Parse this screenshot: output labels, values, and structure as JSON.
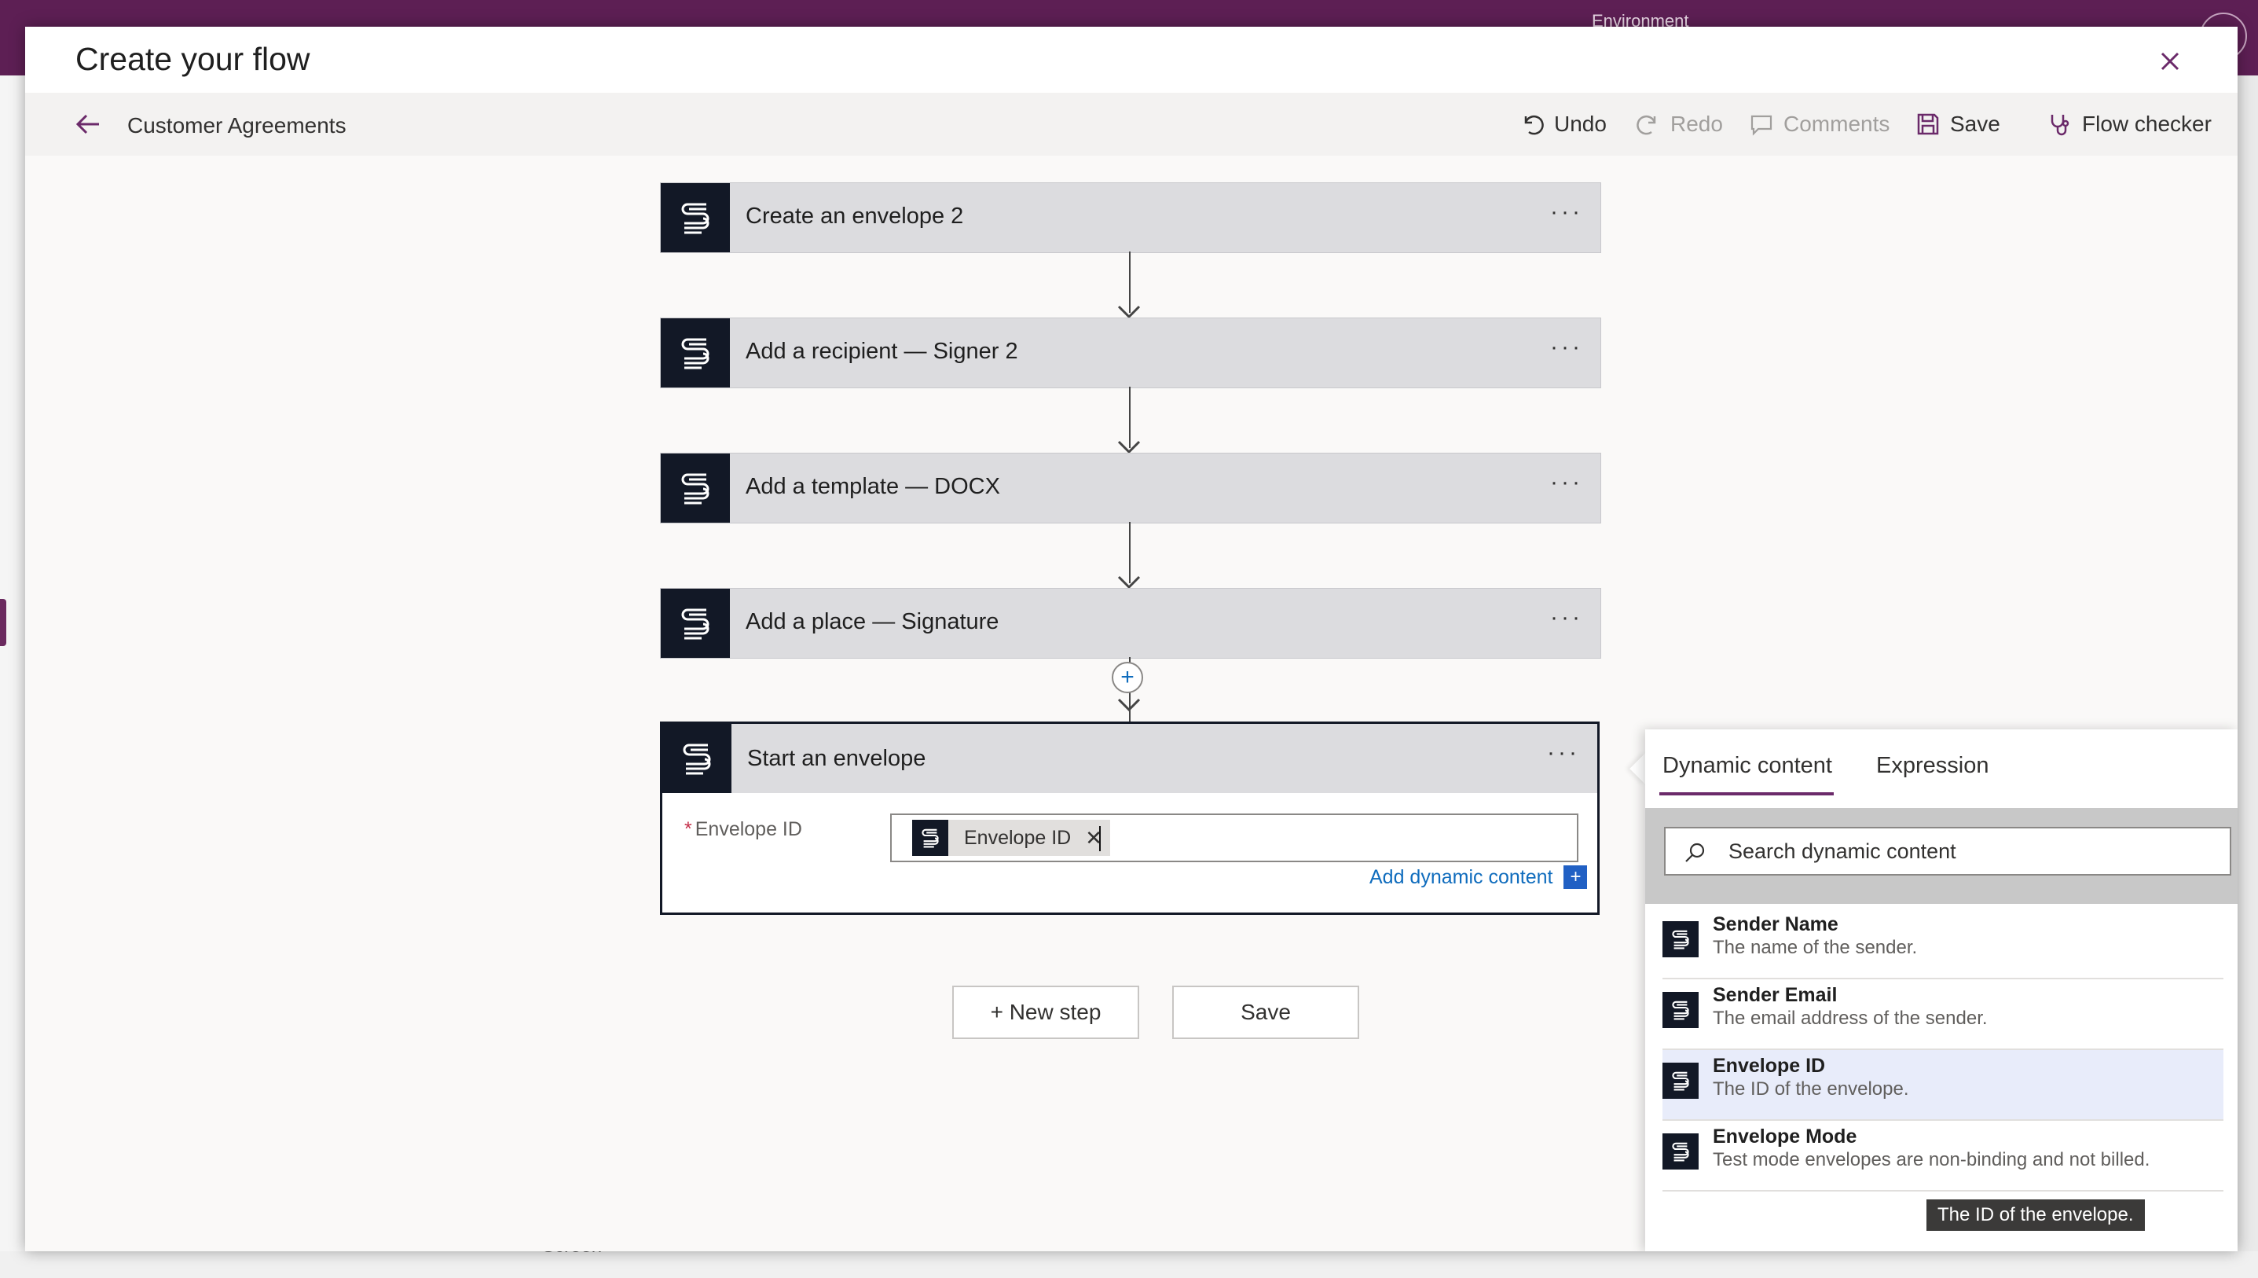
{
  "background": {
    "environment_label": "Environment",
    "screen_label": "Screen"
  },
  "dialog": {
    "title": "Create your flow",
    "close_icon": "close-icon"
  },
  "toolbar": {
    "flow_name": "Customer Agreements",
    "undo": "Undo",
    "redo": "Redo",
    "comments": "Comments",
    "save": "Save",
    "flow_checker": "Flow checker"
  },
  "steps": [
    {
      "title": "Create an envelope 2"
    },
    {
      "title": "Add a recipient — Signer 2"
    },
    {
      "title": "Add a template — DOCX"
    },
    {
      "title": "Add a place — Signature"
    }
  ],
  "active_step": {
    "title": "Start an envelope",
    "field_label": "Envelope ID",
    "token_label": "Envelope ID",
    "add_dynamic": "Add dynamic content"
  },
  "buttons": {
    "new_step": "+ New step",
    "save": "Save"
  },
  "dynamic_panel": {
    "tab_dynamic": "Dynamic content",
    "tab_expression": "Expression",
    "search_placeholder": "Search dynamic content",
    "items": [
      {
        "name": "Sender Name",
        "desc": "The name of the sender."
      },
      {
        "name": "Sender Email",
        "desc": "The email address of the sender."
      },
      {
        "name": "Envelope ID",
        "desc": "The ID of the envelope."
      },
      {
        "name": "Envelope Mode",
        "desc": "Test mode envelopes are non-binding and not billed."
      }
    ],
    "tooltip": "The ID of the envelope."
  },
  "colors": {
    "brand_purple": "#5d1f54",
    "accent_blue": "#0f6cbd",
    "connector_logo": "#121826"
  }
}
